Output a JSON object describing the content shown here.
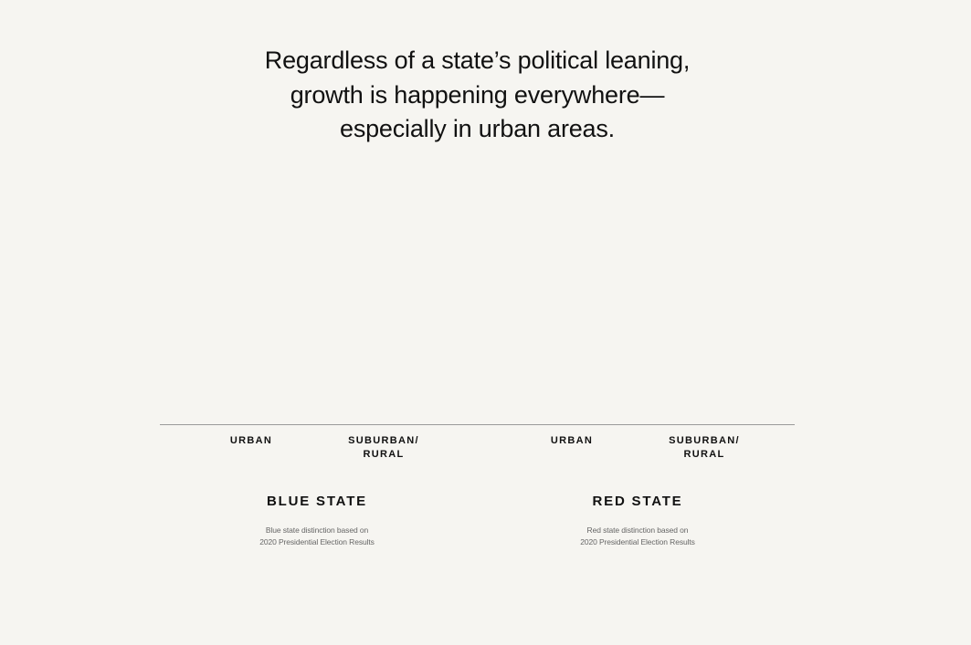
{
  "headline": {
    "line1": "Regardless of a state’s political leaning,",
    "line2": "growth is happening everywhere—",
    "line3": "especially in urban areas."
  },
  "groups": [
    {
      "title": "BLUE STATE",
      "note_line1": "Blue state distinction based on",
      "note_line2": "2020 Presidential Election Results",
      "categories": [
        {
          "line1": "URBAN",
          "line2": ""
        },
        {
          "line1": "SUBURBAN/",
          "line2": "RURAL"
        }
      ]
    },
    {
      "title": "RED STATE",
      "note_line1": "Red state distinction based on",
      "note_line2": "2020 Presidential Election Results",
      "categories": [
        {
          "line1": "URBAN",
          "line2": ""
        },
        {
          "line1": "SUBURBAN/",
          "line2": "RURAL"
        }
      ]
    }
  ],
  "colors": {
    "background": "#f6f5f1",
    "baseline": "#9a9a9a",
    "text": "#111111",
    "note": "#666666"
  },
  "chart_data": {
    "type": "bar",
    "title": "Regardless of a state’s political leaning, growth is happening everywhere—especially in urban areas.",
    "groups": [
      "BLUE STATE",
      "RED STATE"
    ],
    "categories": [
      "URBAN",
      "SUBURBAN/ RURAL"
    ],
    "series": [
      {
        "group": "BLUE STATE",
        "values": [
          null,
          null
        ]
      },
      {
        "group": "RED STATE",
        "values": [
          null,
          null
        ]
      }
    ],
    "grid": false,
    "legend": "none"
  }
}
